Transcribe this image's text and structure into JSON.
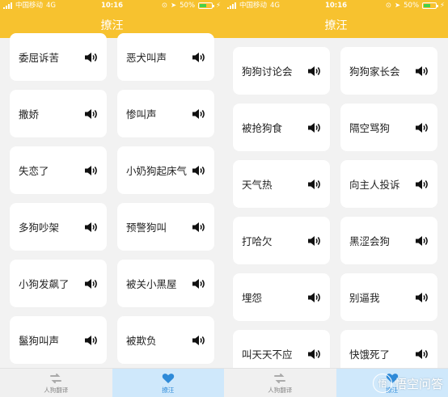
{
  "status": {
    "carrier": "中国移动",
    "network": "4G",
    "time": "10:16",
    "battery_text": "50%"
  },
  "app": {
    "title": "撩汪"
  },
  "left_screen": {
    "cards": [
      {
        "label": "委屈诉苦"
      },
      {
        "label": "恶犬叫声"
      },
      {
        "label": "撒娇"
      },
      {
        "label": "惨叫声"
      },
      {
        "label": "失恋了"
      },
      {
        "label": "小奶狗起床气"
      },
      {
        "label": "多狗吵架"
      },
      {
        "label": "预警狗叫"
      },
      {
        "label": "小狗发飙了"
      },
      {
        "label": "被关小黑屋"
      },
      {
        "label": "鬣狗叫声"
      },
      {
        "label": "被欺负"
      }
    ]
  },
  "right_screen": {
    "cards": [
      {
        "label": "狗狗讨论会"
      },
      {
        "label": "狗狗家长会"
      },
      {
        "label": "被抢狗食"
      },
      {
        "label": "隔空骂狗"
      },
      {
        "label": "天气热"
      },
      {
        "label": "向主人投诉"
      },
      {
        "label": "打哈欠"
      },
      {
        "label": "黑涩会狗"
      },
      {
        "label": "埋怨"
      },
      {
        "label": "别逼我"
      },
      {
        "label": "叫天天不应"
      },
      {
        "label": "快饿死了"
      }
    ]
  },
  "tabs": [
    {
      "label": "人狗翻译",
      "icon": "translate-icon",
      "active": false
    },
    {
      "label": "撩汪",
      "icon": "heart-icon",
      "active": true
    }
  ],
  "watermark": {
    "text": "悟空问答"
  },
  "colors": {
    "header": "#f7c22f",
    "active_tab_bg": "#cfe8fb",
    "active_tab_fg": "#2e8ad8"
  }
}
